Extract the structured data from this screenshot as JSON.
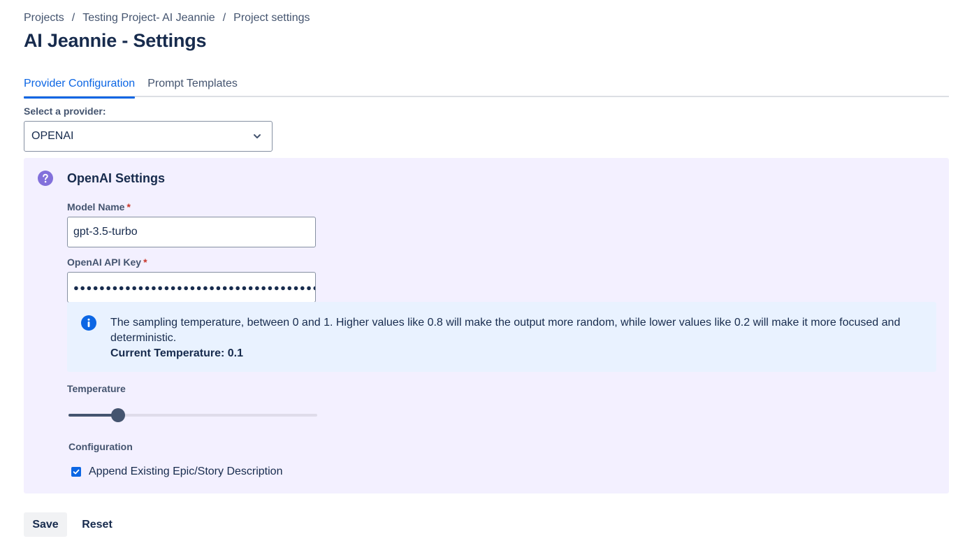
{
  "breadcrumb": {
    "items": [
      "Projects",
      "Testing Project- AI Jeannie",
      "Project settings"
    ],
    "separator": "/"
  },
  "page": {
    "title": "AI Jeannie - Settings"
  },
  "tabs": [
    {
      "label": "Provider Configuration",
      "active": true
    },
    {
      "label": "Prompt Templates",
      "active": false
    }
  ],
  "provider": {
    "label": "Select a provider:",
    "selected": "OPENAI"
  },
  "openai": {
    "title": "OpenAI Settings",
    "model_label": "Model Name",
    "model_value": "gpt-3.5-turbo",
    "api_key_label": "OpenAI API Key",
    "api_key_masked": "●●●●●●●●●●●●●●●●●●●●●●●●●●●●●●●●●●●●●●●●●●●●●●●●●",
    "required_marker": "*"
  },
  "info": {
    "text": "The sampling temperature, between 0 and 1. Higher values like 0.8 will make the output more random, while lower values like 0.2 will make it more focused and deterministic.",
    "current_temperature": "Current Temperature: 0.1"
  },
  "temperature": {
    "label": "Temperature",
    "value": 0.1,
    "min": 0,
    "max": 1
  },
  "configuration": {
    "label": "Configuration",
    "append_description": {
      "label": "Append Existing Epic/Story Description",
      "checked": true
    }
  },
  "actions": {
    "save_label": "Save",
    "reset_label": "Reset"
  },
  "colors": {
    "accent": "#0c66e4",
    "panel_bg": "#f3f0ff",
    "info_bg": "#e9f2ff",
    "help_icon": "#8270db",
    "slider": "#44546f"
  },
  "icons": {
    "help": "question-circle-icon",
    "info": "info-circle-icon",
    "select": "chevron-down-icon",
    "check": "check-icon"
  }
}
